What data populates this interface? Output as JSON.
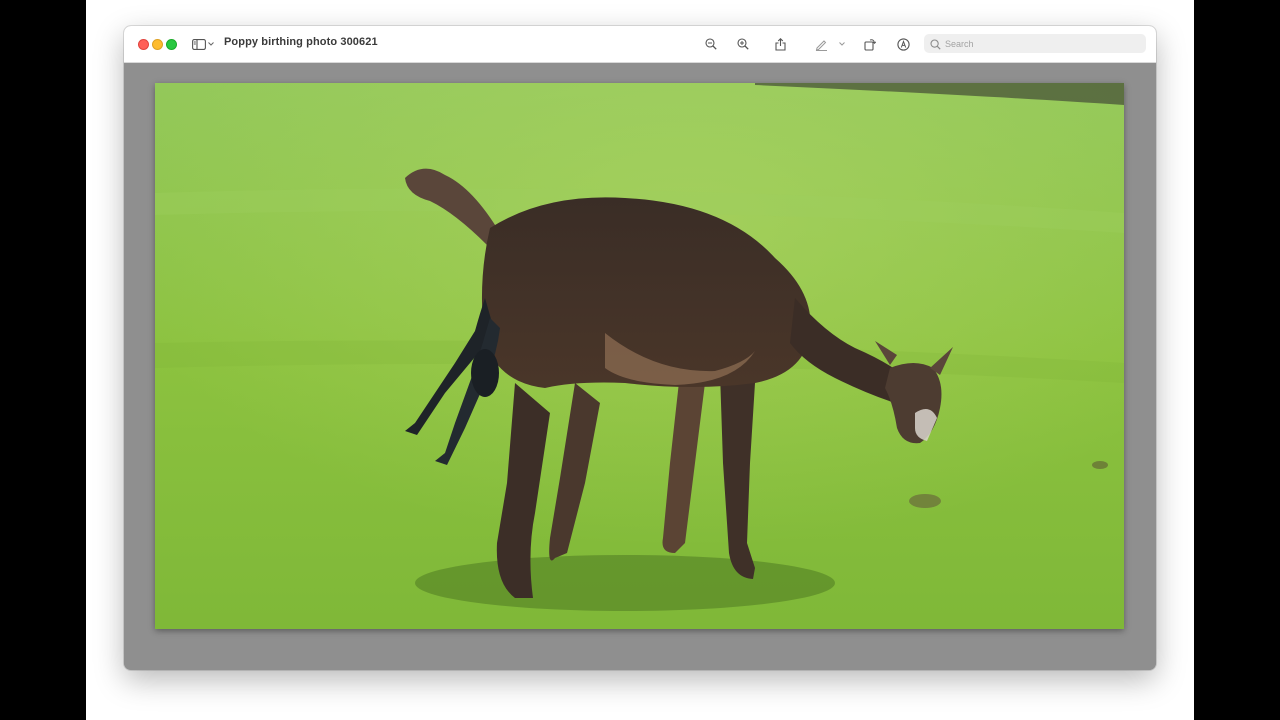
{
  "window": {
    "title": "Poppy birthing photo 300621",
    "traffic_lights": {
      "close_color": "#ff5f57",
      "minimize_color": "#febc2e",
      "zoom_color": "#28c840"
    }
  },
  "toolbar": {
    "icons": [
      "sidebar-icon",
      "chevron-down-icon",
      "zoom-out-icon",
      "zoom-in-icon",
      "share-icon",
      "markup-pen-icon",
      "chevron-down-icon",
      "rotate-icon",
      "annotate-icon"
    ],
    "search_placeholder": "Search"
  },
  "photo": {
    "subject": "dark brown alpaca giving birth in a green field",
    "colors": {
      "grass": "#8cc63f",
      "alpaca": "#3d2f28",
      "cria": "#1e2328"
    }
  }
}
